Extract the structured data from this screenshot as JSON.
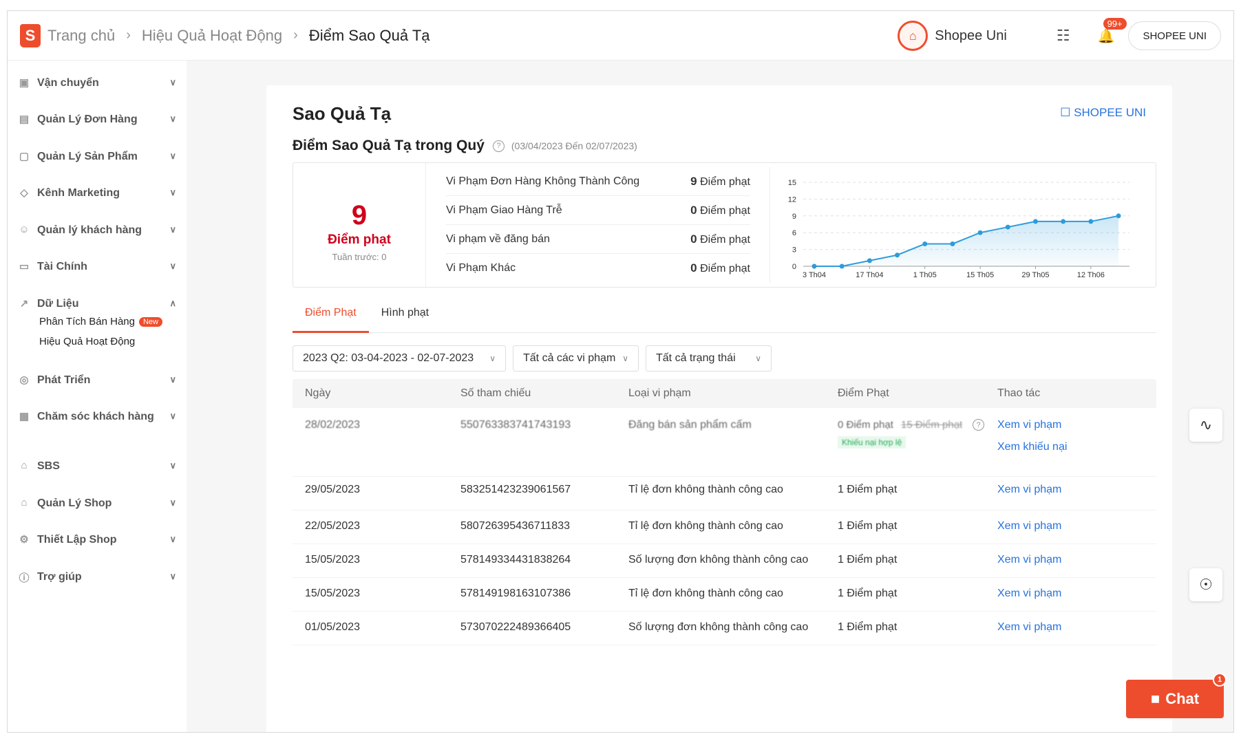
{
  "header": {
    "logo": "S",
    "breadcrumbs": [
      "Trang chủ",
      "Hiệu Quả Hoạt Động",
      "Điểm Sao Quả Tạ"
    ],
    "uni_label": "Shopee Uni",
    "notif_count": "99+",
    "user_button": "SHOPEE UNI"
  },
  "sidebar": {
    "items": [
      {
        "label": "Vận chuyển",
        "icon": "truck-icon"
      },
      {
        "label": "Quản Lý Đơn Hàng",
        "icon": "clipboard-icon"
      },
      {
        "label": "Quản Lý Sản Phẩm",
        "icon": "bag-icon"
      },
      {
        "label": "Kênh Marketing",
        "icon": "tag-icon"
      },
      {
        "label": "Quản lý khách hàng",
        "icon": "user-icon"
      },
      {
        "label": "Tài Chính",
        "icon": "wallet-icon"
      },
      {
        "label": "Dữ Liệu",
        "icon": "chart-icon"
      },
      {
        "label": "Phát Triển",
        "icon": "medal-icon"
      },
      {
        "label": "Chăm sóc khách hàng",
        "icon": "support-icon"
      },
      {
        "label": "SBS",
        "icon": "warehouse-icon"
      },
      {
        "label": "Quản Lý Shop",
        "icon": "shop-icon"
      },
      {
        "label": "Thiết Lập Shop",
        "icon": "gear-icon"
      },
      {
        "label": "Trợ giúp",
        "icon": "help-icon"
      }
    ],
    "data_sub": [
      "Phân Tích Bán Hàng",
      "Hiệu Quả Hoạt Động"
    ],
    "new_badge": "New"
  },
  "main": {
    "title": "Sao Quả Tạ",
    "uni_link": "SHOPEE UNI",
    "subtitle": "Điểm Sao Quả Tạ trong Quý",
    "period": "(03/04/2023 Đến 02/07/2023)",
    "score": "9",
    "score_unit": "Điểm phạt",
    "prev_week": "Tuần trước: 0",
    "violations": [
      {
        "label": "Vi Phạm Đơn Hàng Không Thành Công",
        "value": "9",
        "unit": "Điểm phạt"
      },
      {
        "label": "Vi Phạm Giao Hàng Trễ",
        "value": "0",
        "unit": "Điểm phạt"
      },
      {
        "label": "Vi phạm về đăng bán",
        "value": "0",
        "unit": "Điểm phạt"
      },
      {
        "label": "Vi Phạm Khác",
        "value": "0",
        "unit": "Điểm phạt"
      }
    ],
    "tabs": [
      "Điểm Phạt",
      "Hình phạt"
    ],
    "filters": [
      "2023 Q2: 03-04-2023 - 02-07-2023",
      "Tất cả các vi phạm",
      "Tất cả trạng thái"
    ],
    "table": {
      "headers": [
        "Ngày",
        "Số tham chiếu",
        "Loại vi phạm",
        "Điểm Phạt",
        "Thao tác"
      ],
      "first_row": {
        "date": "28/02/2023",
        "ref": "550763383741743193",
        "type": "Đăng bán sản phẩm cấm",
        "points": "0 Điểm phạt",
        "old_points": "15 Điểm phạt",
        "badge": "Khiếu nại hợp lệ",
        "action1": "Xem vi phạm",
        "action2": "Xem khiếu nại"
      },
      "rows": [
        {
          "date": "29/05/2023",
          "ref": "583251423239061567",
          "type": "Tỉ lệ đơn không thành công cao",
          "points": "1 Điểm phạt",
          "action": "Xem vi phạm"
        },
        {
          "date": "22/05/2023",
          "ref": "580726395436711833",
          "type": "Tỉ lệ đơn không thành công cao",
          "points": "1 Điểm phạt",
          "action": "Xem vi phạm"
        },
        {
          "date": "15/05/2023",
          "ref": "578149334431838264",
          "type": "Số lượng đơn không thành công cao",
          "points": "1 Điểm phạt",
          "action": "Xem vi phạm"
        },
        {
          "date": "15/05/2023",
          "ref": "578149198163107386",
          "type": "Tỉ lệ đơn không thành công cao",
          "points": "1 Điểm phạt",
          "action": "Xem vi phạm"
        },
        {
          "date": "01/05/2023",
          "ref": "573070222489366405",
          "type": "Số lượng đơn không thành công cao",
          "points": "1 Điểm phạt",
          "action": "Xem vi phạm"
        }
      ]
    }
  },
  "chart_data": {
    "type": "area",
    "x_ticks": [
      "3 Th04",
      "17 Th04",
      "1 Th05",
      "15 Th05",
      "29 Th05",
      "12 Th06"
    ],
    "y_ticks": [
      0,
      3,
      6,
      9,
      12,
      15
    ],
    "ylim": [
      0,
      15
    ],
    "values": [
      0,
      0,
      1,
      2,
      4,
      4,
      6,
      7,
      8,
      8,
      8,
      9
    ],
    "color": "#2d9cdb",
    "grid": true
  },
  "chat": {
    "label": "Chat",
    "badge": "1"
  },
  "colors": {
    "brand": "#ee4d2d",
    "link": "#2673dd",
    "danger": "#d0011b"
  }
}
